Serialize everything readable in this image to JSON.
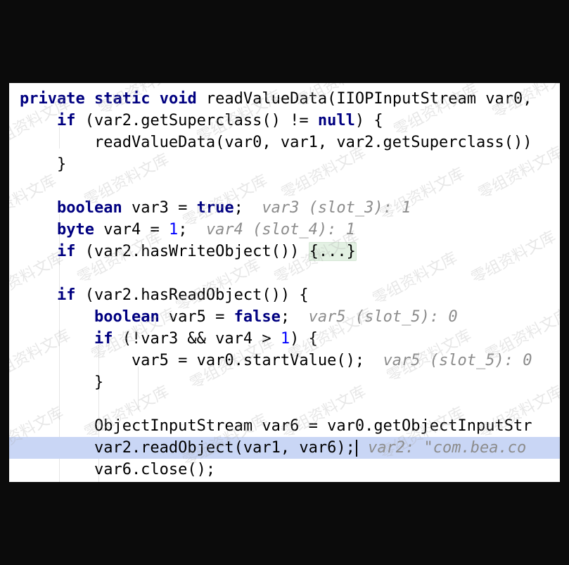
{
  "editor": {
    "lines": [
      [
        {
          "t": "private",
          "c": "kw"
        },
        {
          "t": " ",
          "c": "plain"
        },
        {
          "t": "static",
          "c": "kw"
        },
        {
          "t": " ",
          "c": "plain"
        },
        {
          "t": "void",
          "c": "kw"
        },
        {
          "t": " readValueData(IIOPInputStream var0,",
          "c": "plain"
        }
      ],
      [
        {
          "t": "    ",
          "c": "plain"
        },
        {
          "t": "if",
          "c": "kw"
        },
        {
          "t": " (var2.getSuperclass() != ",
          "c": "plain"
        },
        {
          "t": "null",
          "c": "kw"
        },
        {
          "t": ") {",
          "c": "plain"
        }
      ],
      [
        {
          "t": "        readValueData(var0, var1, var2.getSuperclass())",
          "c": "plain"
        }
      ],
      [
        {
          "t": "    }",
          "c": "plain"
        }
      ],
      [],
      [
        {
          "t": "    ",
          "c": "plain"
        },
        {
          "t": "boolean",
          "c": "kw"
        },
        {
          "t": " var3 = ",
          "c": "plain"
        },
        {
          "t": "true",
          "c": "kw"
        },
        {
          "t": ";  ",
          "c": "plain"
        },
        {
          "t": "var3 (slot_3): 1",
          "c": "hint"
        }
      ],
      [
        {
          "t": "    ",
          "c": "plain"
        },
        {
          "t": "byte",
          "c": "kw"
        },
        {
          "t": " var4 = ",
          "c": "plain"
        },
        {
          "t": "1",
          "c": "num"
        },
        {
          "t": ";  ",
          "c": "plain"
        },
        {
          "t": "var4 (slot_4): 1",
          "c": "hint"
        }
      ],
      [
        {
          "t": "    ",
          "c": "plain"
        },
        {
          "t": "if",
          "c": "kw"
        },
        {
          "t": " (var2.hasWriteObject()) ",
          "c": "plain"
        },
        {
          "t": "{...}",
          "c": "fold"
        }
      ],
      [],
      [
        {
          "t": "    ",
          "c": "plain"
        },
        {
          "t": "if",
          "c": "kw"
        },
        {
          "t": " (var2.hasReadObject()) {",
          "c": "plain"
        }
      ],
      [
        {
          "t": "        ",
          "c": "plain"
        },
        {
          "t": "boolean",
          "c": "kw"
        },
        {
          "t": " var5 = ",
          "c": "plain"
        },
        {
          "t": "false",
          "c": "kw"
        },
        {
          "t": ";  ",
          "c": "plain"
        },
        {
          "t": "var5 (slot_5): 0",
          "c": "hint"
        }
      ],
      [
        {
          "t": "        ",
          "c": "plain"
        },
        {
          "t": "if",
          "c": "kw"
        },
        {
          "t": " (!var3 && var4 > ",
          "c": "plain"
        },
        {
          "t": "1",
          "c": "num"
        },
        {
          "t": ") {",
          "c": "plain"
        }
      ],
      [
        {
          "t": "            var5 = var0.startValue();  ",
          "c": "plain"
        },
        {
          "t": "var5 (slot_5): 0",
          "c": "hint"
        }
      ],
      [
        {
          "t": "        }",
          "c": "plain"
        }
      ],
      [],
      [
        {
          "t": "        ObjectInputStream var6 = var0.getObjectInputStr",
          "c": "plain"
        }
      ],
      [
        {
          "t": "        var2.readObject(var1, var6);",
          "c": "plain"
        },
        {
          "t": "",
          "c": "caret"
        },
        {
          "t": " var2: \"com.bea.co",
          "c": "hint"
        }
      ],
      [
        {
          "t": "        var6.close();",
          "c": "plain"
        }
      ]
    ],
    "highlighted_line": 16
  },
  "watermark": {
    "text": "零组资料文库"
  }
}
